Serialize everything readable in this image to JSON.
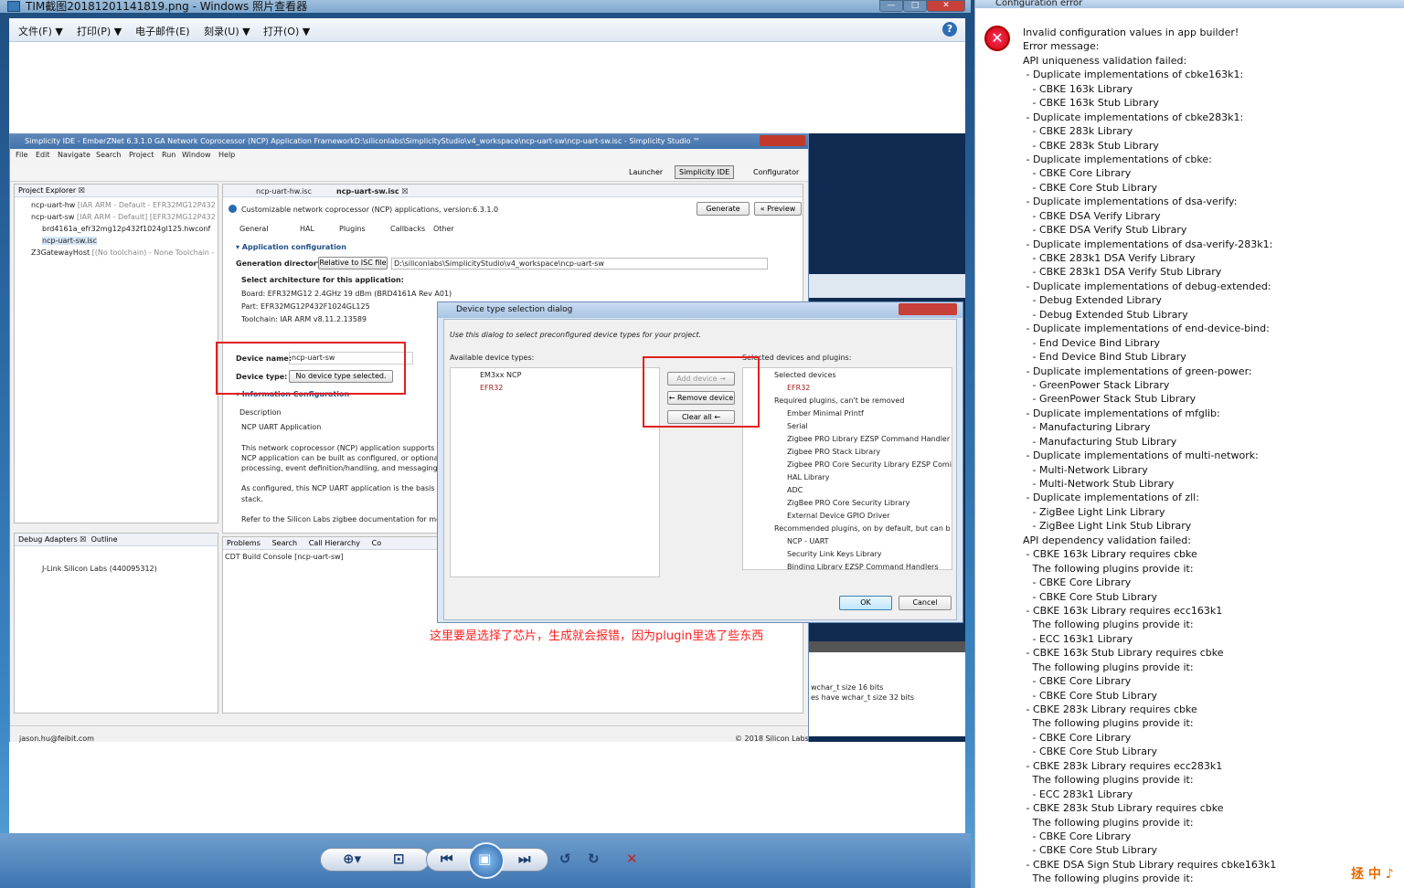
{
  "photo_viewer": {
    "title": "TIM截图20181201141819.png - Windows 照片查看器",
    "menu": [
      "文件(F) ▼",
      "打印(P) ▼",
      "电子邮件(E)",
      "刻录(U) ▼",
      "打开(O) ▼"
    ],
    "help": "?",
    "controls": {
      "min": "—",
      "max": "□",
      "close": "✕"
    },
    "toolbar_icons": [
      "⊕▾",
      "⊡",
      "⏮",
      "▣",
      "⏭",
      "↺",
      "↻",
      "✕"
    ]
  },
  "studio": {
    "title": "Simplicity IDE - EmberZNet 6.3.1.0 GA Network Coprocessor (NCP) Application FrameworkD:\\siliconlabs\\SimplicityStudio\\v4_workspace\\ncp-uart-sw\\ncp-uart-sw.isc - Simplicity Studio ™",
    "menu": [
      "File",
      "Edit",
      "Navigate",
      "Search",
      "Project",
      "Run",
      "Window",
      "Help"
    ],
    "perspectives": [
      "Launcher",
      "Simplicity IDE",
      "Configurator"
    ],
    "project_explorer": {
      "header": "Project Explorer ☒",
      "items": [
        {
          "name": "ncp-uart-hw",
          "detail": "[IAR ARM - Default - EFR32MG12P432"
        },
        {
          "name": "ncp-uart-sw",
          "detail": "[IAR ARM - Default] [EFR32MG12P432"
        },
        {
          "name": "brd4161a_efr32mg12p432f1024gl125.hwconf",
          "detail": ""
        },
        {
          "name": "ncp-uart-sw.isc",
          "detail": ""
        },
        {
          "name": "Z3GatewayHost",
          "detail": "[(No toolchain) - None Toolchain -"
        }
      ]
    },
    "editor_tabs": [
      "ncp-uart-hw.isc",
      "ncp-uart-sw.isc ☒"
    ],
    "info": "Customizable network coprocessor (NCP) applications, version:6.3.1.0",
    "generate": "Generate",
    "preview": "« Preview",
    "config_tabs": [
      "General",
      "HAL",
      "Plugins",
      "Callbacks",
      "Other"
    ],
    "app_config": "▾ Application configuration",
    "gen_dir_label": "Generation directory:",
    "relative_btn": "Relative to ISC file",
    "gen_dir_value": "D:\\siliconlabs\\SimplicityStudio\\v4_workspace\\ncp-uart-sw",
    "arch_label": "Select architecture for this application:",
    "board": "Board: EFR32MG12 2.4GHz 19 dBm (BRD4161A Rev A01)",
    "part": "Part: EFR32MG12P432F1024GL125",
    "toolchain": "Toolchain: IAR ARM v8.11.2.13589",
    "device_name_label": "Device name:",
    "device_name_value": "ncp-uart-sw",
    "device_type_label": "Device type:",
    "device_type_btn": "No device type selected.",
    "info_config": "▾ Information Configuration",
    "description_label": "Description",
    "desc_lines": [
      "NCP UART Application",
      "This network coprocessor (NCP) application supports co",
      "NCP application can be built as configured, or optionally",
      "processing, event definition/handling, and messaging wit",
      "As configured, this NCP UART application is the basis for",
      "stack.",
      "Refer to the Silicon Labs zigbee documentation for more"
    ],
    "debug_adapters": "Debug Adapters ☒",
    "outline": "Outline",
    "jlink": "J-Link Silicon Labs (440095312)",
    "console_tabs": [
      "Problems",
      "Search",
      "Call Hierarchy",
      "Co"
    ],
    "console_title": "CDT Build Console [ncp-uart-sw]",
    "status_user": "jason.hu@feibit.com",
    "status_copy": "© 2018 Silicon Labs",
    "right_bits": [
      "wchar_t size 16 bits",
      "es have wchar_t size 32 bits"
    ]
  },
  "dialog": {
    "title": "Device type selection dialog",
    "intro": "Use this dialog to select preconfigured device types for your project.",
    "available_label": "Available device types:",
    "available": [
      "EM3xx NCP",
      "EFR32"
    ],
    "add": "Add device →",
    "remove": "← Remove device",
    "clear": "Clear all ←",
    "selected_label": "Selected devices and plugins:",
    "selected": [
      "Selected devices",
      "EFR32",
      "Required plugins, can't be removed",
      "Ember Minimal Printf",
      "Serial",
      "Zigbee PRO Library EZSP Command Handler",
      "Zigbee PRO Stack Library",
      "Zigbee PRO Core Security Library EZSP Comi",
      "HAL Library",
      "ADC",
      "ZigBee PRO Core Security Library",
      "External Device GPIO Driver",
      "Recommended plugins, on by default, but can b",
      "NCP - UART",
      "Security Link Keys Library",
      "Binding Library EZSP Command Handlers"
    ],
    "ok": "OK",
    "cancel": "Cancel"
  },
  "annotation": "这里要是选择了芯片，生成就会报错，因为plugin里选了些东西",
  "config_error": {
    "title": "Configuration error",
    "lines": [
      "Invalid configuration values in app builder!",
      "Error message:",
      "API uniqueness validation failed:",
      " - Duplicate implementations of cbke163k1:",
      "   - CBKE 163k Library",
      "   - CBKE 163k Stub Library",
      " - Duplicate implementations of cbke283k1:",
      "   - CBKE 283k Library",
      "   - CBKE 283k Stub Library",
      " - Duplicate implementations of cbke:",
      "   - CBKE Core Library",
      "   - CBKE Core Stub Library",
      " - Duplicate implementations of dsa-verify:",
      "   - CBKE DSA Verify Library",
      "   - CBKE DSA Verify Stub Library",
      " - Duplicate implementations of dsa-verify-283k1:",
      "   - CBKE 283k1 DSA Verify Library",
      "   - CBKE 283k1 DSA Verify Stub Library",
      " - Duplicate implementations of debug-extended:",
      "   - Debug Extended Library",
      "   - Debug Extended Stub Library",
      " - Duplicate implementations of end-device-bind:",
      "   - End Device Bind Library",
      "   - End Device Bind Stub Library",
      " - Duplicate implementations of green-power:",
      "   - GreenPower Stack Library",
      "   - GreenPower Stack Stub Library",
      " - Duplicate implementations of mfglib:",
      "   - Manufacturing Library",
      "   - Manufacturing Stub Library",
      " - Duplicate implementations of multi-network:",
      "   - Multi-Network Library",
      "   - Multi-Network Stub Library",
      " - Duplicate implementations of zll:",
      "   - ZigBee Light Link Library",
      "   - ZigBee Light Link Stub Library",
      "API dependency validation failed:",
      " - CBKE 163k Library requires cbke",
      "   The following plugins provide it:",
      "   - CBKE Core Library",
      "   - CBKE Core Stub Library",
      " - CBKE 163k Library requires ecc163k1",
      "   The following plugins provide it:",
      "   - ECC 163k1 Library",
      " - CBKE 163k Stub Library requires cbke",
      "   The following plugins provide it:",
      "   - CBKE Core Library",
      "   - CBKE Core Stub Library",
      " - CBKE 283k Library requires cbke",
      "   The following plugins provide it:",
      "   - CBKE Core Library",
      "   - CBKE Core Stub Library",
      " - CBKE 283k Library requires ecc283k1",
      "   The following plugins provide it:",
      "   - ECC 283k1 Library",
      " - CBKE 283k Stub Library requires cbke",
      "   The following plugins provide it:",
      "   - CBKE Core Library",
      "   - CBKE Core Stub Library",
      " - CBKE DSA Sign Stub Library requires cbke163k1",
      "   The following plugins provide it:"
    ]
  },
  "tray": "拯 中 ♪"
}
